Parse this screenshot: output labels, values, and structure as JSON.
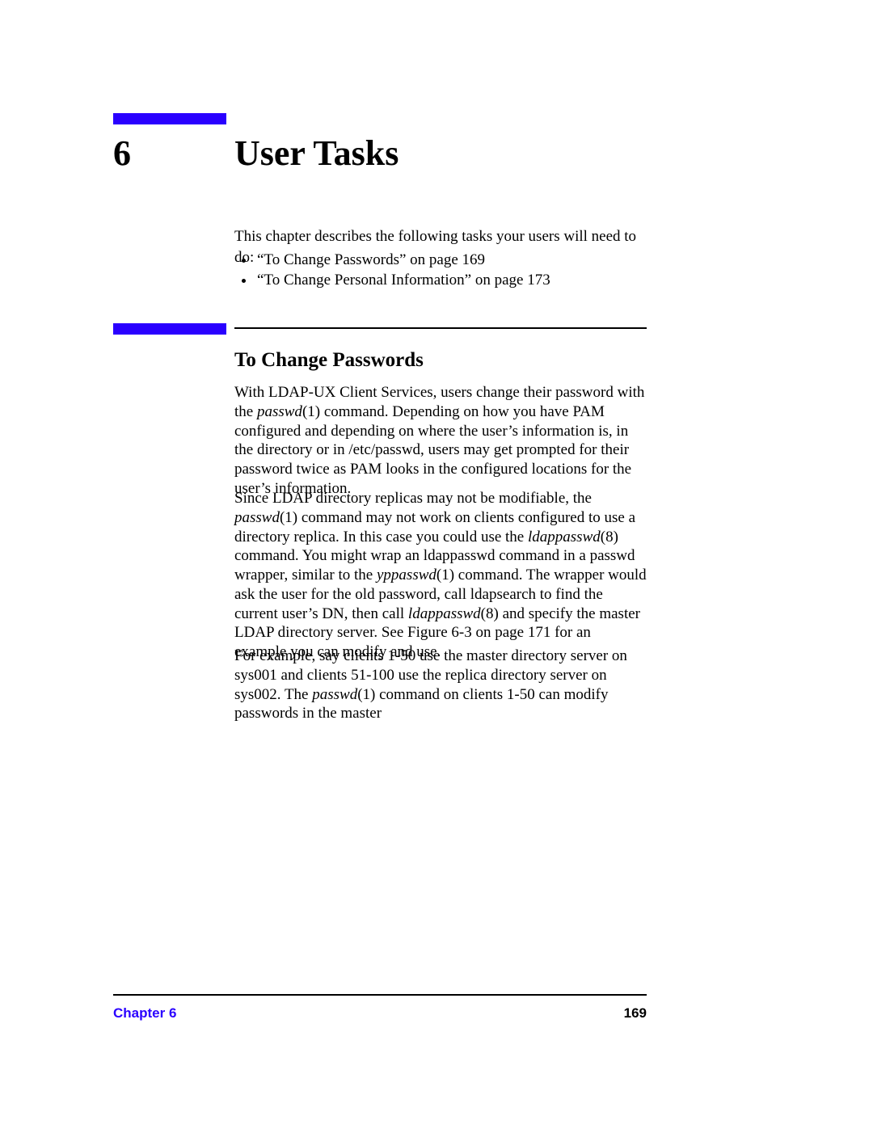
{
  "chapter": {
    "number": "6",
    "title": "User Tasks"
  },
  "intro": "This chapter describes the following tasks your users will need to do:",
  "bullets": [
    "“To Change Passwords” on page 169",
    "“To Change Personal Information” on page 173"
  ],
  "section": {
    "heading": "To Change Passwords",
    "p1": {
      "s0": "With LDAP-UX Client Services, users change their password with the ",
      "i1": "passwd",
      "s1": "(1) command. Depending on how you have PAM configured and depending on where the user’s information is, in the directory or in /etc/passwd, users may get prompted for their password twice as PAM looks in the configured locations for the user’s information."
    },
    "p2": {
      "s0": "Since LDAP directory replicas may not be modifiable, the ",
      "i1": "passwd",
      "s1": "(1) command may not work on clients configured to use a directory replica. In this case you could use the ",
      "i2": "ldappasswd",
      "s2": "(8) command. You might wrap an ldappasswd command in a passwd wrapper, similar to the ",
      "i3": "yppasswd",
      "s3": "(1) command. The wrapper would ask the user for the old password, call ldapsearch to find the current user’s DN, then call ",
      "i4": "ldappasswd",
      "s4": "(8) and specify the master LDAP directory server. See Figure 6-3 on page 171 for an example you can modify and use."
    },
    "p3": {
      "s0": "For example, say clients 1-50 use the master directory server on sys001 and clients 51-100 use the replica directory server on sys002. The ",
      "i1": "passwd",
      "s1": "(1) command on clients 1-50 can modify passwords in the master"
    }
  },
  "footer": {
    "left": "Chapter 6",
    "right": "169"
  }
}
